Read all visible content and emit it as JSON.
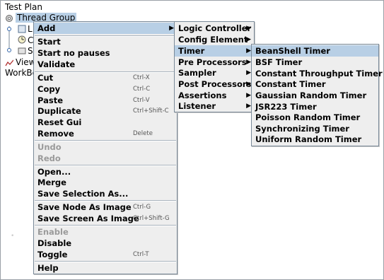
{
  "tree": {
    "test_plan": "Test Plan",
    "thread_group": "Thread Group",
    "child_a": "L",
    "child_b": "C",
    "child_c": "S",
    "view": "View",
    "workbench": "WorkBe"
  },
  "context_menu": {
    "add": "Add",
    "start": "Start",
    "start_no_pauses": "Start no pauses",
    "validate": "Validate",
    "cut": "Cut",
    "cut_key": "Ctrl-X",
    "copy": "Copy",
    "copy_key": "Ctrl-C",
    "paste": "Paste",
    "paste_key": "Ctrl-V",
    "duplicate": "Duplicate",
    "duplicate_key": "Ctrl+Shift-C",
    "reset_gui": "Reset Gui",
    "remove": "Remove",
    "remove_key": "Delete",
    "undo": "Undo",
    "redo": "Redo",
    "open": "Open...",
    "merge": "Merge",
    "save_selection": "Save Selection As...",
    "save_node_image": "Save Node As Image",
    "save_node_key": "Ctrl-G",
    "save_screen_image": "Save Screen As Image",
    "save_screen_key": "Ctrl+Shift-G",
    "enable": "Enable",
    "disable": "Disable",
    "toggle": "Toggle",
    "toggle_key": "Ctrl-T",
    "help": "Help"
  },
  "add_menu": {
    "logic_controller": "Logic Controller",
    "config_element": "Config Element",
    "timer": "Timer",
    "pre_processors": "Pre Processors",
    "sampler": "Sampler",
    "post_processors": "Post Processors",
    "assertions": "Assertions",
    "listener": "Listener"
  },
  "timer_menu": {
    "items": [
      "BeanShell Timer",
      "BSF Timer",
      "Constant Throughput Timer",
      "Constant Timer",
      "Gaussian Random Timer",
      "JSR223 Timer",
      "Poisson Random Timer",
      "Synchronizing Timer",
      "Uniform Random Timer"
    ]
  },
  "colors": {
    "highlight": "#b8cfe5",
    "menu_bg": "#eeeeee",
    "disabled": "#9a9a9a"
  }
}
